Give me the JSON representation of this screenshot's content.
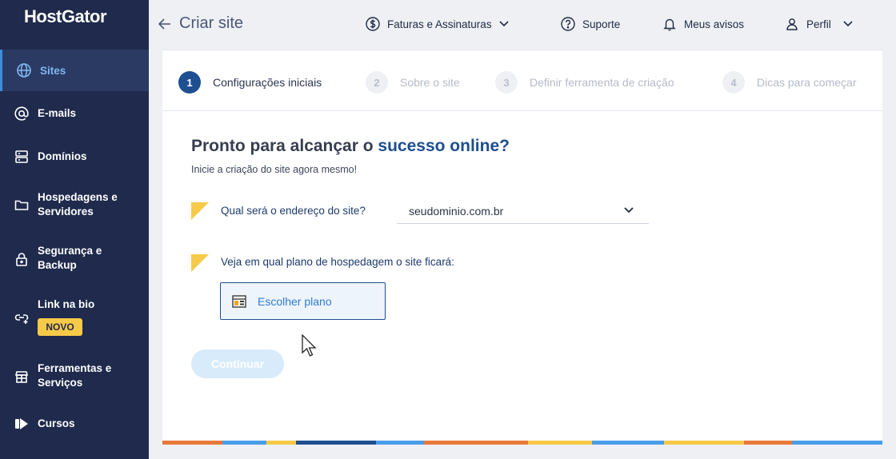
{
  "sidebar": {
    "logo": "HostGator",
    "items": [
      {
        "label_1": "Sites",
        "label_2": "",
        "icon": "globe-icon"
      },
      {
        "label_1": "E-mails",
        "label_2": "",
        "icon": "at-icon"
      },
      {
        "label_1": "Domínios",
        "label_2": "",
        "icon": "server-icon"
      },
      {
        "label_1": "Hospedagens e",
        "label_2": "Servidores",
        "icon": "folder-icon"
      },
      {
        "label_1": "Segurança e",
        "label_2": "Backup",
        "icon": "lock-icon"
      },
      {
        "label_1": "Link na bio",
        "label_2": "",
        "icon": "link-icon"
      },
      {
        "label_1": "Ferramentas e",
        "label_2": "Serviços",
        "icon": "store-icon"
      },
      {
        "label_1": "Cursos",
        "label_2": "",
        "icon": "play-icon"
      }
    ],
    "badge": "NOVO"
  },
  "header": {
    "title": "Criar site",
    "invoices": "Faturas e Assinaturas",
    "support": "Suporte",
    "notices": "Meus avisos",
    "profile": "Perfil"
  },
  "steps": [
    {
      "num": "1",
      "label": "Configurações iniciais"
    },
    {
      "num": "2",
      "label": "Sobre o site"
    },
    {
      "num": "3",
      "label": "Definir ferramenta de criação"
    },
    {
      "num": "4",
      "label": "Dicas para começar"
    }
  ],
  "main": {
    "headline_prefix": "Pronto para alcançar o ",
    "headline_highlight": "sucesso online?",
    "subtitle": "Inicie a criação do site agora mesmo!",
    "q_address": "Qual será o endereço do site?",
    "domain_value": "seudominio.com.br",
    "q_plan": "Veja em qual plano de hospedagem o site ficará:",
    "plan_button": "Escolher plano",
    "continue_button": "Continuar"
  },
  "colors": {
    "sidebar_bg": "#1f2a4c",
    "brand_blue": "#1d4f91",
    "accent_yellow": "#f7c948",
    "link_blue": "#2f7bd0"
  }
}
